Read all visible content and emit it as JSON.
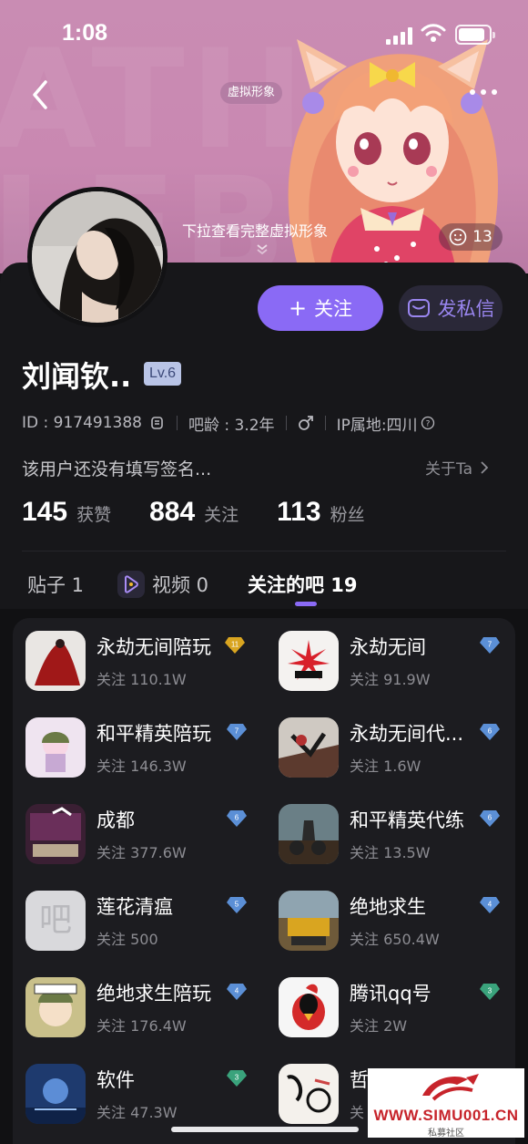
{
  "status_bar": {
    "time": "1:08"
  },
  "header": {
    "avatar_tag": "虚拟形象",
    "pull_hint": "下拉查看完整虚拟形象",
    "like_count": "13"
  },
  "profile": {
    "username": "刘闻钦..",
    "level": "Lv.6",
    "id_text": "ID : 917491388",
    "bar_age": "吧龄 : 3.2年",
    "ip_location": "IP属地:四川",
    "signature": "该用户还没有填写签名...",
    "about_label": "关于Ta",
    "follow_button": "关注",
    "dm_button": "发私信"
  },
  "stats": [
    {
      "value": "145",
      "label": "获赞"
    },
    {
      "value": "884",
      "label": "关注"
    },
    {
      "value": "113",
      "label": "粉丝"
    }
  ],
  "tabs": [
    {
      "label": "贴子 1"
    },
    {
      "label": "视频 0"
    },
    {
      "label": "关注的吧 19"
    }
  ],
  "bars": [
    {
      "name": "永劫无间陪玩",
      "followers": "关注 110.1W",
      "level": "11",
      "gem_color": "#d9a520"
    },
    {
      "name": "永劫无间",
      "followers": "关注 91.9W",
      "level": "7",
      "gem_color": "#5b8fd6"
    },
    {
      "name": "和平精英陪玩",
      "followers": "关注 146.3W",
      "level": "7",
      "gem_color": "#5b8fd6"
    },
    {
      "name": "永劫无间代...",
      "followers": "关注 1.6W",
      "level": "6",
      "gem_color": "#5b8fd6"
    },
    {
      "name": "成都",
      "followers": "关注 377.6W",
      "level": "6",
      "gem_color": "#5b8fd6"
    },
    {
      "name": "和平精英代练",
      "followers": "关注 13.5W",
      "level": "6",
      "gem_color": "#5b8fd6"
    },
    {
      "name": "莲花清瘟",
      "followers": "关注 500",
      "level": "5",
      "gem_color": "#5b8fd6"
    },
    {
      "name": "绝地求生",
      "followers": "关注 650.4W",
      "level": "4",
      "gem_color": "#5b8fd6"
    },
    {
      "name": "绝地求生陪玩",
      "followers": "关注 176.4W",
      "level": "4",
      "gem_color": "#5b8fd6"
    },
    {
      "name": "腾讯qq号",
      "followers": "关注 2W",
      "level": "3",
      "gem_color": "#3aa37c"
    },
    {
      "name": "软件",
      "followers": "关注 47.3W",
      "level": "3",
      "gem_color": "#3aa37c"
    },
    {
      "name": "哲",
      "followers": "关",
      "level": "",
      "gem_color": "#3aa37c"
    }
  ],
  "placeholder_thumb_char": "吧",
  "corner_watermark": {
    "url": "WWW.SIMU001.CN",
    "sub": "私募社区"
  },
  "colors": {
    "accent": "#8a6af5",
    "banner": "#c98cb3",
    "background": "#111113"
  }
}
